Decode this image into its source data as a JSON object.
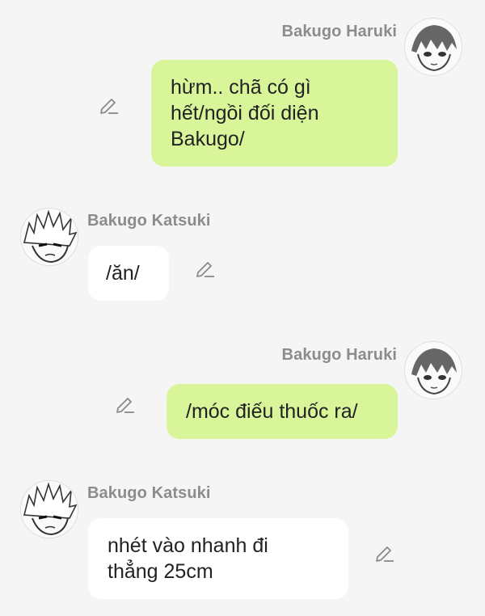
{
  "messages": [
    {
      "sender": "Bakugo Haruki",
      "side": "right",
      "lines": [
        "hừm.. chã có gì",
        "hết/ngồi đối diện",
        "Bakugo/"
      ]
    },
    {
      "sender": "Bakugo Katsuki",
      "side": "left",
      "lines": [
        "/ăn/"
      ]
    },
    {
      "sender": "Bakugo Haruki",
      "side": "right",
      "lines": [
        "/móc điếu thuốc ra/"
      ]
    },
    {
      "sender": "Bakugo Katsuki",
      "side": "left",
      "lines": [
        "nhét vào nhanh đi",
        "thẳng 25cm"
      ]
    }
  ],
  "icons": {
    "edit": "pencil-icon",
    "haruki_avatar": "manga-avatar-haruki",
    "katsuki_avatar": "manga-avatar-katsuki"
  },
  "colors": {
    "background": "#f5f5f5",
    "my_bubble": "#d8f59a",
    "other_bubble": "#ffffff",
    "name_text": "#8c8c8c",
    "message_text": "#222222"
  }
}
